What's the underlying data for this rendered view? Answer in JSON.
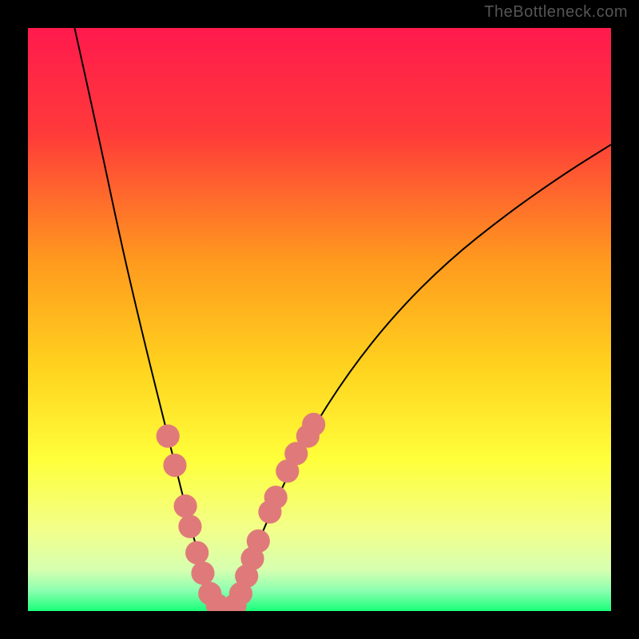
{
  "watermark": "TheBottleneck.com",
  "chart_data": {
    "type": "line",
    "title": "",
    "xlabel": "",
    "ylabel": "",
    "xlim": [
      0,
      100
    ],
    "ylim": [
      0,
      100
    ],
    "gradient_stops": [
      {
        "offset": 0.0,
        "color": "#ff1a4d"
      },
      {
        "offset": 0.18,
        "color": "#ff3a3a"
      },
      {
        "offset": 0.4,
        "color": "#ff9a1e"
      },
      {
        "offset": 0.58,
        "color": "#ffd21e"
      },
      {
        "offset": 0.74,
        "color": "#ffff3a"
      },
      {
        "offset": 0.86,
        "color": "#f2ff8a"
      },
      {
        "offset": 0.93,
        "color": "#d6ffb0"
      },
      {
        "offset": 0.965,
        "color": "#8cffb0"
      },
      {
        "offset": 1.0,
        "color": "#1aff7a"
      }
    ],
    "series": [
      {
        "name": "left-branch",
        "x": [
          8,
          12,
          16,
          20,
          24,
          26,
          28,
          29.5,
          31,
          32.5,
          34
        ],
        "values": [
          100,
          82,
          63,
          46,
          30,
          22,
          14,
          9,
          4,
          1.5,
          0
        ]
      },
      {
        "name": "right-branch",
        "x": [
          34,
          36,
          38,
          40,
          43,
          48,
          55,
          63,
          72,
          82,
          92,
          100
        ],
        "values": [
          0,
          3,
          8,
          13,
          20,
          30,
          41,
          51,
          60,
          68,
          75,
          80
        ]
      }
    ],
    "markers": {
      "name": "highlight-points",
      "color": "#e07a7a",
      "radius": 2.0,
      "points": [
        {
          "x": 24.0,
          "y": 30.0
        },
        {
          "x": 25.2,
          "y": 25.0
        },
        {
          "x": 27.0,
          "y": 18.0
        },
        {
          "x": 27.8,
          "y": 14.5
        },
        {
          "x": 29.0,
          "y": 10.0
        },
        {
          "x": 30.0,
          "y": 6.5
        },
        {
          "x": 31.2,
          "y": 3.0
        },
        {
          "x": 32.5,
          "y": 1.0
        },
        {
          "x": 34.0,
          "y": 0.3
        },
        {
          "x": 35.5,
          "y": 1.0
        },
        {
          "x": 36.5,
          "y": 3.0
        },
        {
          "x": 37.5,
          "y": 6.0
        },
        {
          "x": 38.5,
          "y": 9.0
        },
        {
          "x": 39.5,
          "y": 12.0
        },
        {
          "x": 41.5,
          "y": 17.0
        },
        {
          "x": 42.5,
          "y": 19.5
        },
        {
          "x": 44.5,
          "y": 24.0
        },
        {
          "x": 46.0,
          "y": 27.0
        },
        {
          "x": 48.0,
          "y": 30.0
        },
        {
          "x": 49.0,
          "y": 32.0
        }
      ]
    }
  }
}
